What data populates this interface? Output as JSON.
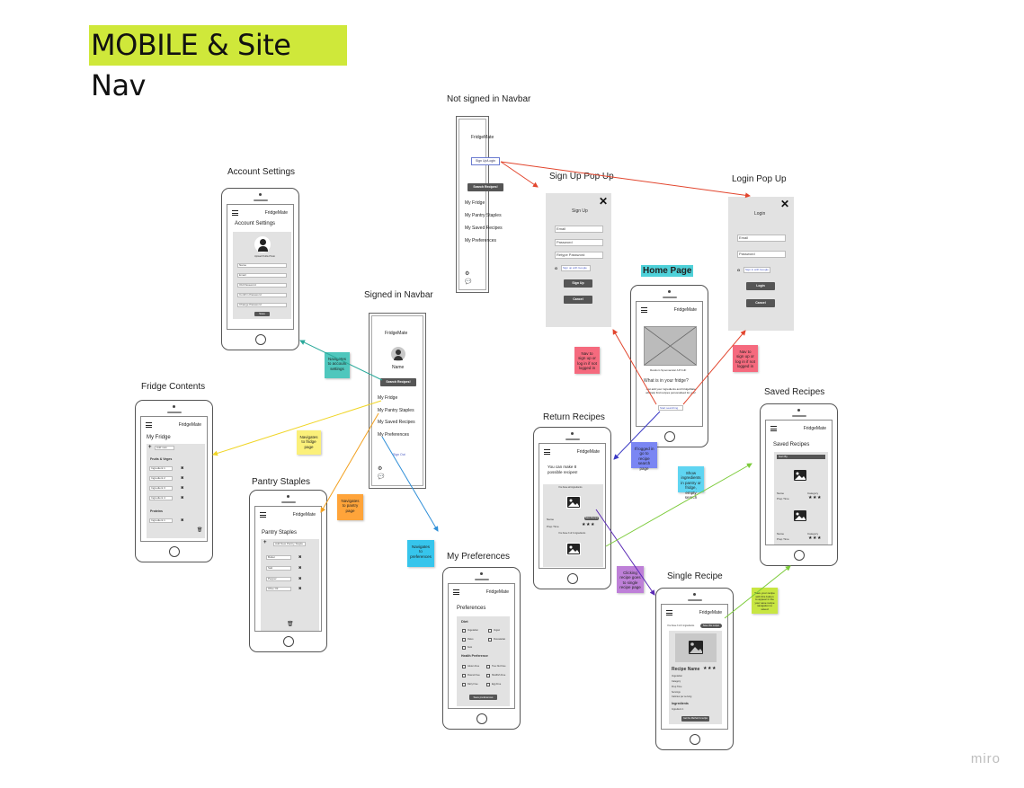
{
  "board_title": "MOBILE & Site Nav",
  "labels": {
    "not_signed_in": "Not signed in Navbar",
    "account_settings": "Account Settings",
    "signed_in": "Signed in Navbar",
    "sign_up_popup": "Sign Up Pop Up",
    "login_popup": "Login Pop Up",
    "home_page": "Home Page",
    "fridge_contents": "Fridge Contents",
    "pantry_staples": "Pantry Staples",
    "return_recipes": "Return Recipes",
    "saved_recipes": "Saved Recipes",
    "my_preferences": "My Preferences",
    "single_recipe": "Single Recipe"
  },
  "brand": "FridgeMate",
  "not_signed_in_nav": {
    "brand": "FridgeMate",
    "sign_up_button": "Sign Up/Login",
    "search_button": "Search Recipes!",
    "items": [
      "My Fridge",
      "My Pantry Staples",
      "My Saved Recipes",
      "My Preferences"
    ]
  },
  "signed_in_nav": {
    "brand": "FridgeMate",
    "name": "Name",
    "search_button": "Search Recipes!",
    "items": [
      "My Fridge",
      "My Pantry Staples",
      "My Saved Recipes",
      "My Preferences"
    ],
    "sign_out": "Sign Out"
  },
  "account_settings": {
    "heading": "Account Settings",
    "photo_caption": "Upload Profile Photo",
    "fields": [
      "Name",
      "Email",
      "Old Password",
      "Confirm Password",
      "Change Password"
    ],
    "save": "Save"
  },
  "signup": {
    "title": "Sign Up",
    "fields": [
      "Email",
      "Password",
      "Retype Password"
    ],
    "google": "Sign up with Google",
    "submit": "Sign Up",
    "cancel": "Cancel"
  },
  "login": {
    "title": "Login",
    "fields": [
      "Email",
      "Password"
    ],
    "google": "Sign in with Google",
    "submit": "Login",
    "cancel": "Cancel"
  },
  "home": {
    "caption": "Random Spoonacular API GIF",
    "question": "What is in your fridge?",
    "desc": "Just add your ingredients and FridgeMate will help find recipes personalised for you!",
    "cta": "Start searching today"
  },
  "fridge": {
    "heading": "My Fridge",
    "add_placeholder": "Add new",
    "section1": "Fruits & Veges",
    "items1": [
      "Ingredient 1",
      "Ingredient 2",
      "Ingredient 3",
      "Ingredient 4"
    ],
    "section2": "Proteins",
    "items2": [
      "Ingredient 1"
    ]
  },
  "pantry": {
    "heading": "Pantry Staples",
    "add_placeholder": "Add New Pantry Staple",
    "items": [
      "Butter",
      "Salt",
      "Pepper",
      "Olive Oil"
    ]
  },
  "return_recipes": {
    "heading": "You can make 8 possible recipes!",
    "card1_caption": "You have all ingredients",
    "name_label": "Name",
    "save_tag": "Save Recipe",
    "prep_label": "Prep Time",
    "card2_caption": "You have 3 of 4 ingredients"
  },
  "saved_recipes": {
    "heading": "Saved Recipes",
    "filter": "Sort By",
    "name_label": "Name",
    "category_label": "Category",
    "prep_label": "Prep Time",
    "stars": "★★★"
  },
  "preferences": {
    "heading": "Preferences",
    "diet_label": "Diet",
    "diet_options": [
      "Vegetarian",
      "Vegan",
      "Paleo",
      "Pescatarian",
      "Keto"
    ],
    "health_label": "Health Preference",
    "health_options": [
      "Gluten Free",
      "Tree Nut Free",
      "Peanut Free",
      "Shellfish Free",
      "Dairy Free",
      "Egg Free"
    ],
    "save": "Save preferences"
  },
  "single_recipe": {
    "top_caption": "You have 3 of 4 ingredients",
    "save_button": "Save this recipe!",
    "name": "Recipe Name",
    "stars": "★★★",
    "meta": [
      "Vegetarian",
      "Category",
      "Prep Time",
      "Servings",
      "Calories per serving"
    ],
    "ingredients_label": "Ingredients",
    "ingredient1": "Ingredient 1",
    "method_button": "Get the Method & recipe"
  },
  "stickies": {
    "account": "Navigates to account settings",
    "fridge": "Navigates to fridge page",
    "pantry": "Navigates to pantry page",
    "preferences": "Navigates to preferences",
    "nav_signup_1": "Nav to sign up or log in if not logged in",
    "nav_signup_2": "Nav to sign up or log in if not logged in",
    "if_logged_in": "If logged in go to recipe search page",
    "show_ingredients": "Show ingredients in pantry or fridge, empty search",
    "clicking_recipe": "Clicking recipe goes to single recipe page",
    "save_recipe": "Save your recipe with this button to appear in the your save recipe navigation to saved"
  },
  "watermark": "miro",
  "colors": {
    "title_bg": "#cfe83a",
    "home_label_bg": "#4fd1d9",
    "teal_sticky": "#4fc7bd",
    "yellow_sticky": "#fbf07a",
    "orange_sticky": "#ffa43a",
    "cyan_sticky": "#36c5ec",
    "red_sticky": "#f56a7e",
    "blue_sticky": "#7a86f3",
    "lightblue_sticky": "#5fd5f2",
    "purple_sticky": "#be80d8",
    "lime_sticky": "#c8e642"
  }
}
